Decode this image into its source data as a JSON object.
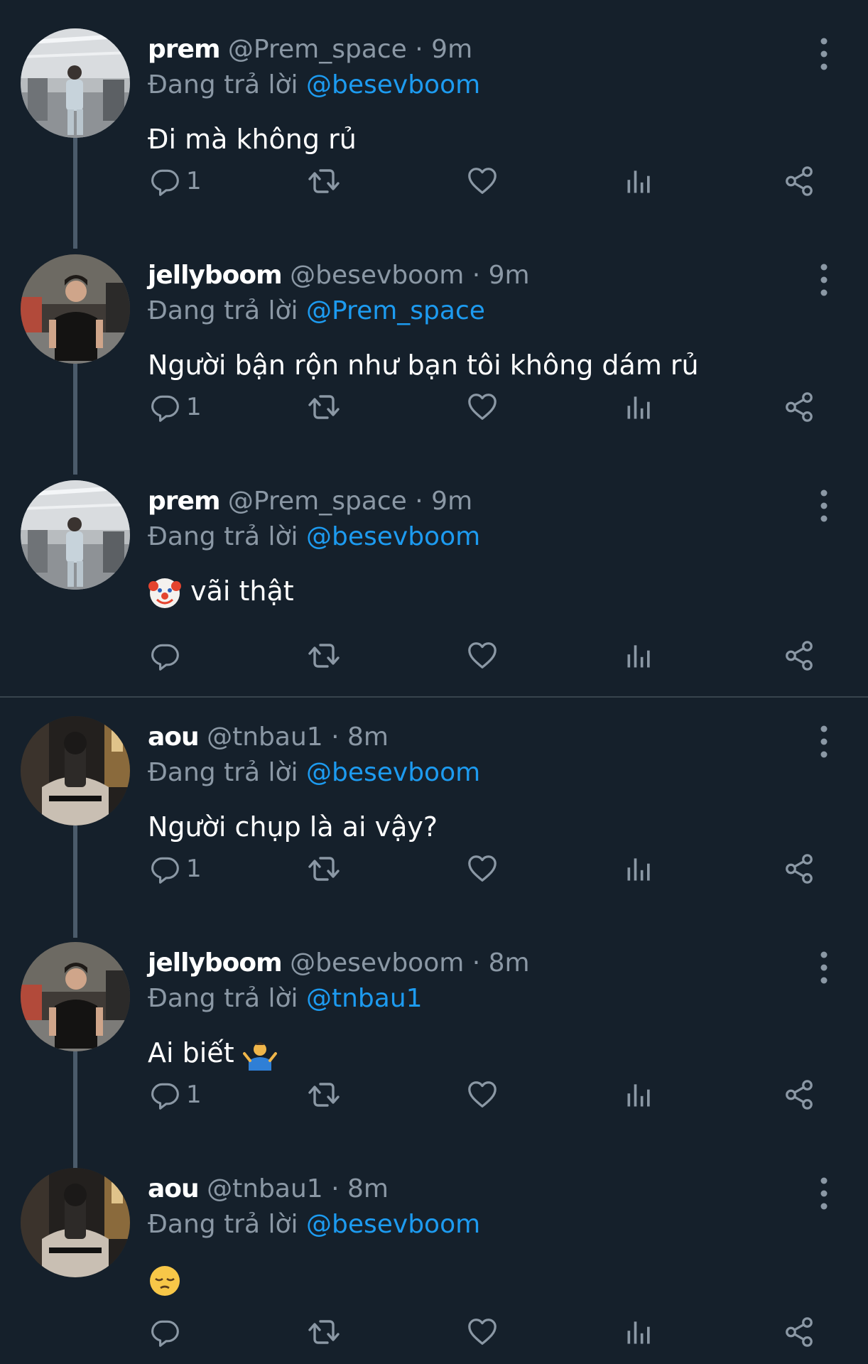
{
  "colors": {
    "background": "#15202b",
    "text": "#ffffff",
    "muted": "#8b98a5",
    "link": "#1d9bf0",
    "thread_line": "#4b5b6b"
  },
  "reply_prefix": "Đang trả lời",
  "icons": {
    "reply": "reply-bubble-icon",
    "retweet": "retweet-icon",
    "like": "heart-icon",
    "views": "views-bar-chart-icon",
    "share": "share-icon",
    "more": "more-vertical-icon"
  },
  "tweets": [
    {
      "name": "prem",
      "handle": "@Prem_space",
      "time": "· 9m",
      "reply_to": "@besevboom",
      "text": "Đi mà không rủ",
      "reply_count": "1"
    },
    {
      "name": "jellyboom",
      "handle": "@besevboom",
      "time": "· 9m",
      "reply_to": "@Prem_space",
      "text": "Người bận rộn như bạn tôi không dám rủ",
      "reply_count": "1"
    },
    {
      "name": "prem",
      "handle": "@Prem_space",
      "time": "· 9m",
      "reply_to": "@besevboom",
      "text": "vãi thật",
      "text_emoji": "clown-face-emoji",
      "reply_count": ""
    },
    {
      "name": "aou",
      "handle": "@tnbau1",
      "time": "· 8m",
      "reply_to": "@besevboom",
      "text": "Người chụp là ai vậy?",
      "reply_count": "1"
    },
    {
      "name": "jellyboom",
      "handle": "@besevboom",
      "time": "· 8m",
      "reply_to": "@tnbau1",
      "text": "Ai biết",
      "text_emoji": "man-shrugging-emoji",
      "reply_count": "1"
    },
    {
      "name": "aou",
      "handle": "@tnbau1",
      "time": "· 8m",
      "reply_to": "@besevboom",
      "text": "",
      "text_emoji": "pensive-face-emoji",
      "reply_count": ""
    }
  ]
}
